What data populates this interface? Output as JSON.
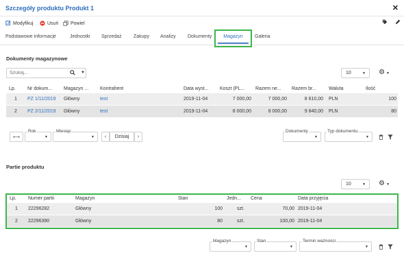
{
  "window": {
    "title": "Szczegóły produktu Produkt 1"
  },
  "toolbar": {
    "modify_label": "Modyfikuj",
    "delete_label": "Usuń",
    "duplicate_label": "Powiel"
  },
  "tabs": [
    {
      "label": "Podstawowe informacje"
    },
    {
      "label": "Jednostki"
    },
    {
      "label": "Sprzedaż"
    },
    {
      "label": "Zakupy"
    },
    {
      "label": "Analizy"
    },
    {
      "label": "Dokumenty"
    },
    {
      "label": "Magazyn",
      "active": true
    },
    {
      "label": "Galeria"
    }
  ],
  "documents": {
    "title": "Dokumenty magazynowe",
    "search_placeholder": "Szukaj...",
    "page_size": "10",
    "columns": [
      "Lp.",
      "Nr dokum...",
      "Magazyn ...",
      "Kontrahent",
      "Data wyst...",
      "Koszt (PL...",
      "Razem ne...",
      "Razem br...",
      "Waluta",
      "Ilość"
    ],
    "rows": [
      {
        "lp": "1",
        "nr": "PZ 1/11/2019",
        "magazyn": "Główny",
        "kontrahent": "test",
        "data": "2019-11-04",
        "koszt": "7 000,00",
        "netto": "7 000,00",
        "brutto": "8 610,00",
        "waluta": "PLN",
        "ilosc": "100"
      },
      {
        "lp": "2",
        "nr": "PZ 2/11/2019",
        "magazyn": "Główny",
        "kontrahent": "test",
        "data": "2019-11-04",
        "koszt": "8 000,00",
        "netto": "8 000,00",
        "brutto": "9 840,00",
        "waluta": "PLN",
        "ilosc": "80"
      }
    ],
    "filters": {
      "year_label": "Rok",
      "month_label": "Miesiąc",
      "today_label": "Dzisiaj",
      "documents_label": "Dokumenty",
      "doc_type_label": "Typ dokumentu"
    }
  },
  "batches": {
    "title": "Partie produktu",
    "page_size": "10",
    "columns": [
      "Lp.",
      "Numer partii",
      "Magazyn",
      "Stan",
      "Jedn...",
      "Cena",
      "Data przyjęcia"
    ],
    "rows": [
      {
        "lp": "1",
        "numer": "22296282",
        "magazyn": "Główny",
        "stan": "100",
        "jedn": "szt.",
        "cena": "70,00",
        "data": "2019-11-04"
      },
      {
        "lp": "2",
        "numer": "22296390",
        "magazyn": "Główny",
        "stan": "80",
        "jedn": "szt.",
        "cena": "100,00",
        "data": "2019-11-04"
      }
    ],
    "filters": {
      "warehouse_label": "Magazyn",
      "stock_label": "Stan",
      "expiry_label": "Termin ważności"
    }
  },
  "colors": {
    "accent": "#2f6ebd",
    "highlight": "#3bb54a",
    "row_alt": "#eeeeee"
  }
}
